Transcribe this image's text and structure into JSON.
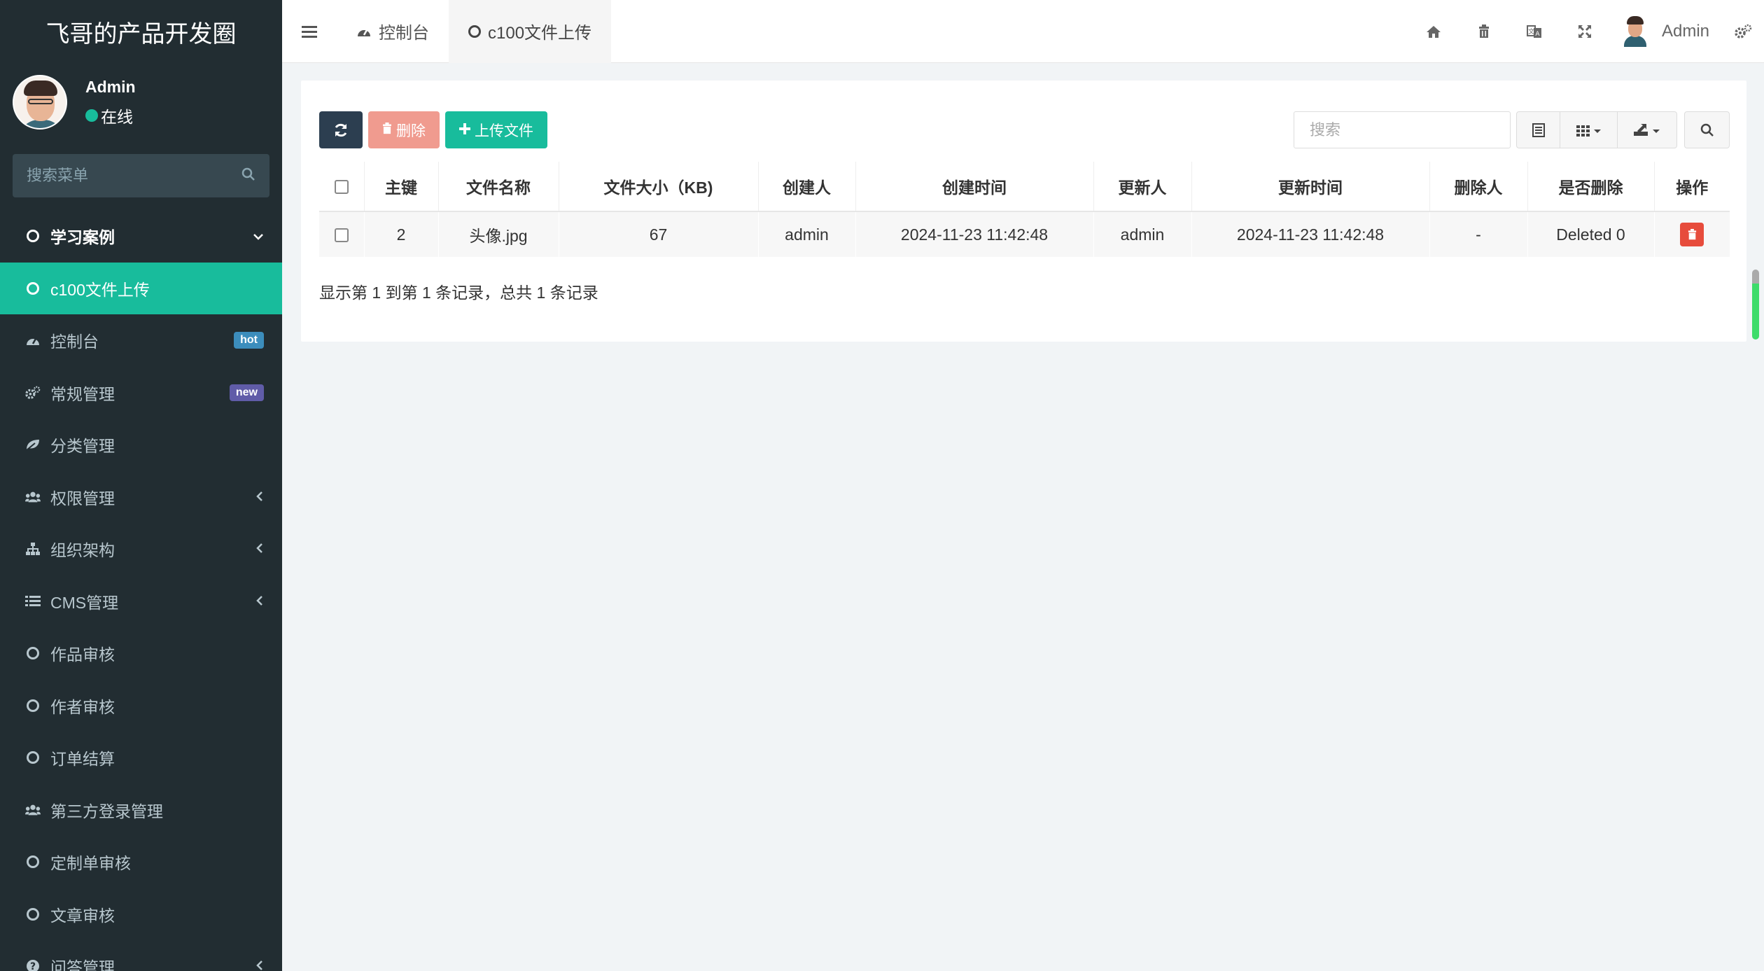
{
  "brand": {
    "title": "飞哥的产品开发圈"
  },
  "user": {
    "name": "Admin",
    "status": "在线"
  },
  "sidebar": {
    "search_placeholder": "搜索菜单",
    "items": [
      {
        "label": "学习案例",
        "icon": "circle-icon"
      },
      {
        "label": "c100文件上传",
        "icon": "circle-icon"
      },
      {
        "label": "控制台",
        "icon": "dashboard-icon",
        "badge": "hot"
      },
      {
        "label": "常规管理",
        "icon": "cogs-icon",
        "badge": "new"
      },
      {
        "label": "分类管理",
        "icon": "leaf-icon"
      },
      {
        "label": "权限管理",
        "icon": "group-icon"
      },
      {
        "label": "组织架构",
        "icon": "sitemap-icon"
      },
      {
        "label": "CMS管理",
        "icon": "list-icon"
      },
      {
        "label": "作品审核",
        "icon": "circle-icon"
      },
      {
        "label": "作者审核",
        "icon": "circle-icon"
      },
      {
        "label": "订单结算",
        "icon": "circle-icon"
      },
      {
        "label": "第三方登录管理",
        "icon": "group-icon"
      },
      {
        "label": "定制单审核",
        "icon": "circle-icon"
      },
      {
        "label": "文章审核",
        "icon": "circle-icon"
      },
      {
        "label": "问答管理",
        "icon": "question-icon"
      }
    ]
  },
  "topbar": {
    "tabs": [
      {
        "label": "控制台"
      },
      {
        "label": "c100文件上传"
      }
    ],
    "user_name": "Admin"
  },
  "toolbar": {
    "delete_label": "删除",
    "upload_label": "上传文件",
    "search_placeholder": "搜索"
  },
  "table": {
    "headers": [
      "主键",
      "文件名称",
      "文件大小（KB)",
      "创建人",
      "创建时间",
      "更新人",
      "更新时间",
      "删除人",
      "是否删除",
      "操作"
    ],
    "rows": [
      {
        "id": "2",
        "filename": "头像.jpg",
        "size": "67",
        "creator": "admin",
        "created_at": "2024-11-23 11:42:48",
        "updater": "admin",
        "updated_at": "2024-11-23 11:42:48",
        "deleter": "-",
        "deleted": "Deleted 0"
      }
    ]
  },
  "pagination": {
    "info": "显示第 1 到第 1 条记录，总共 1 条记录"
  },
  "colors": {
    "sidebar_bg": "#222d32",
    "accent": "#18bc9c",
    "danger": "#e74c3c",
    "dark_btn": "#2c3e50"
  }
}
